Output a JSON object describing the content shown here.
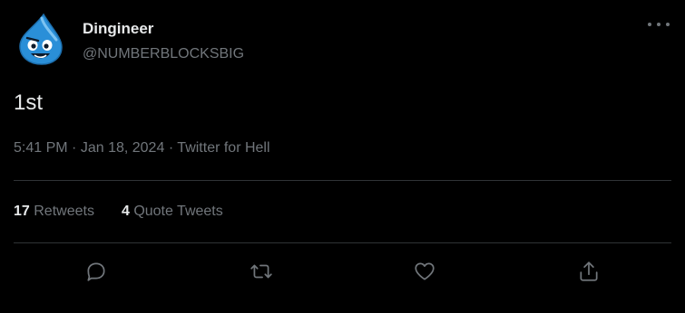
{
  "author": {
    "display_name": "Dingineer",
    "handle": "@NUMBERBLOCKSBIG"
  },
  "tweet": {
    "text": "1st",
    "time": "5:41 PM",
    "date": "Jan 18, 2024",
    "source": "Twitter for Hell",
    "separator": "·"
  },
  "stats": {
    "retweets_count": "17",
    "retweets_label": "Retweets",
    "quotes_count": "4",
    "quotes_label": "Quote Tweets"
  },
  "icons": {
    "more": "more-icon",
    "reply": "reply-icon",
    "retweet": "retweet-icon",
    "like": "like-icon",
    "share": "share-icon"
  },
  "colors": {
    "background": "#000000",
    "text_primary": "#e7e9ea",
    "text_secondary": "#71767b",
    "divider": "#2f3336",
    "avatar_blue": "#2a8fd8"
  }
}
